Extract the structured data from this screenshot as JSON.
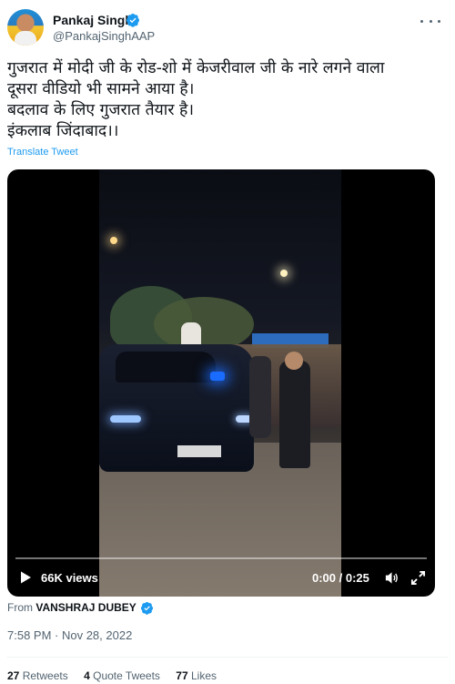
{
  "author": {
    "name": "Pankaj Singh",
    "handle": "@PankajSinghAAP",
    "avatar_icon": "profile-photo",
    "verified_icon": "verified-badge-icon"
  },
  "menu": {
    "icon": "more-dots-icon"
  },
  "tweet": {
    "lines": [
      "गुजरात में मोदी जी के रोड-शो में केजरीवाल जी के नारे लगने वाला",
      "दूसरा वीडियो भी सामने आया है।",
      "बदलाव के लिए गुजरात तैयार है।",
      "इंकलाब जिंदाबाद।।"
    ],
    "translate_label": "Translate Tweet"
  },
  "video": {
    "views": "66K views",
    "time": "0:00 / 0:25",
    "progress": 0,
    "icons": [
      "play-icon",
      "volume-icon",
      "fullscreen-icon"
    ]
  },
  "source": {
    "prefix": "From",
    "name": "VANSHRAJ DUBEY"
  },
  "timestamp": "7:58 PM · Nov 28, 2022",
  "stats": {
    "retweets_count": "27",
    "retweets_label": "Retweets",
    "quotes_count": "4",
    "quotes_label": "Quote Tweets",
    "likes_count": "77",
    "likes_label": "Likes"
  },
  "colors": {
    "accent": "#1d9bf0",
    "text": "#0f1419",
    "secondary": "#536471"
  }
}
